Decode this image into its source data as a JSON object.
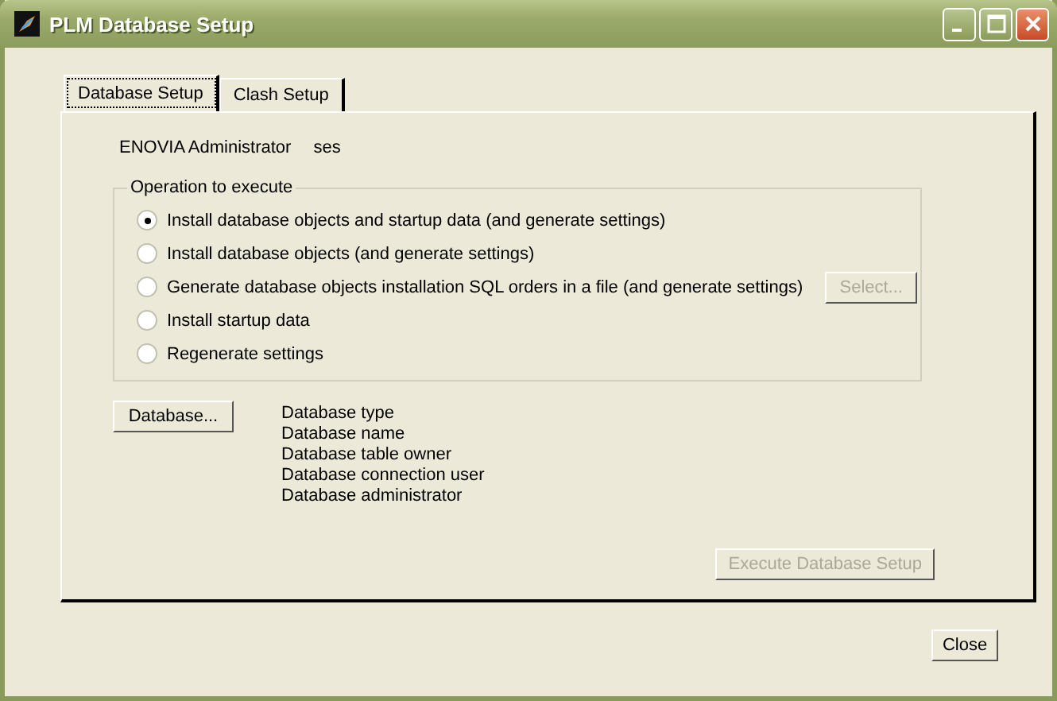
{
  "window": {
    "title": "PLM Database Setup"
  },
  "tabs": [
    {
      "label": "Database Setup",
      "selected": true
    },
    {
      "label": "Clash Setup",
      "selected": false
    }
  ],
  "administrator": {
    "label": "ENOVIA Administrator",
    "value": "ses"
  },
  "operation_group": {
    "title": "Operation to execute",
    "options": [
      {
        "label": "Install database objects and startup data (and generate settings)",
        "selected": true
      },
      {
        "label": "Install database objects (and generate settings)",
        "selected": false
      },
      {
        "label": "Generate database objects installation SQL orders in a file (and generate settings)",
        "selected": false,
        "button": {
          "label": "Select...",
          "disabled": true
        }
      },
      {
        "label": "Install startup data",
        "selected": false
      },
      {
        "label": "Regenerate settings",
        "selected": false
      }
    ]
  },
  "database_button": {
    "label": "Database..."
  },
  "database_info": [
    "Database type",
    "Database name",
    "Database table owner",
    "Database connection user",
    "Database administrator"
  ],
  "execute_button": {
    "label": "Execute Database Setup",
    "disabled": true
  },
  "close_button": {
    "label": "Close"
  }
}
